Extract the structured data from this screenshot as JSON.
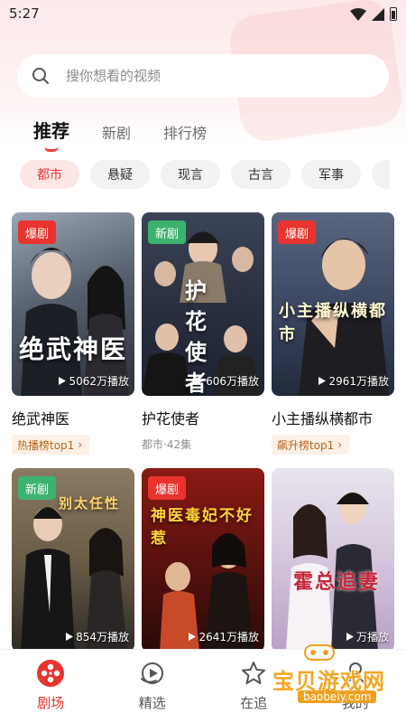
{
  "status_bar": {
    "time": "5:27"
  },
  "search": {
    "placeholder": "搜你想看的视频"
  },
  "tabs": [
    {
      "label": "推荐",
      "active": true
    },
    {
      "label": "新剧",
      "active": false
    },
    {
      "label": "排行榜",
      "active": false
    }
  ],
  "categories": [
    "都市",
    "悬疑",
    "现言",
    "古言",
    "军事"
  ],
  "dramas": [
    {
      "title": "绝武神医",
      "poster_text": "绝武神医",
      "badge": "爆剧",
      "badge_type": "hot",
      "plays": "5062万播放",
      "tag": "热播榜top1",
      "meta": ""
    },
    {
      "title": "护花使者",
      "poster_text": "护花使者",
      "badge": "新剧",
      "badge_type": "new",
      "plays": "606万播放",
      "tag": "",
      "meta": "都市·42集"
    },
    {
      "title": "小主播纵横都市",
      "poster_text": "小主播纵横都市",
      "badge": "爆剧",
      "badge_type": "hot",
      "plays": "2961万播放",
      "tag": "飙升榜top1",
      "meta": ""
    },
    {
      "title": "",
      "poster_text": "别太任性",
      "badge": "新剧",
      "badge_type": "new",
      "plays": "854万播放",
      "tag": "",
      "meta": ""
    },
    {
      "title": "",
      "poster_text": "神医毒妃不好惹",
      "badge": "爆剧",
      "badge_type": "hot",
      "plays": "2641万播放",
      "tag": "",
      "meta": ""
    },
    {
      "title": "",
      "poster_text": "霍总追妻",
      "badge": "",
      "badge_type": "",
      "plays": "万播放",
      "tag": "",
      "meta": ""
    }
  ],
  "bottom_nav": [
    {
      "label": "剧场",
      "icon": "film-reel-icon",
      "active": true
    },
    {
      "label": "精选",
      "icon": "play-circle-icon",
      "active": false
    },
    {
      "label": "在追",
      "icon": "star-icon",
      "active": false
    },
    {
      "label": "我的",
      "icon": "profile-icon",
      "active": false
    }
  ],
  "watermark": {
    "title": "宝贝游戏网",
    "url": "baobeiy.com"
  },
  "colors": {
    "accent": "#e8342e",
    "new_badge": "#3bb36e",
    "tag_text": "#b5651d",
    "chip_active_bg": "#fde6e6"
  }
}
